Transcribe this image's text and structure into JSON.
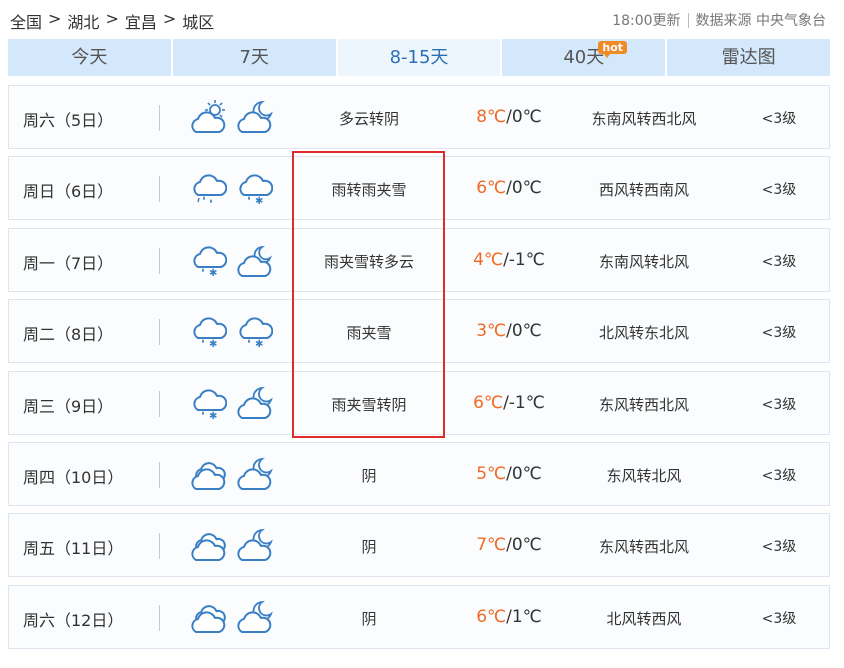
{
  "breadcrumb": {
    "items": [
      "全国",
      "湖北",
      "宜昌",
      "城区"
    ],
    "separator": ">"
  },
  "header": {
    "updated": "18:00更新",
    "source": "数据来源 中央气象台"
  },
  "tabs": [
    {
      "label": "今天"
    },
    {
      "label": "7天"
    },
    {
      "label": "8-15天",
      "active": true
    },
    {
      "label": "40天",
      "badge": "hot"
    },
    {
      "label": "雷达图"
    }
  ],
  "forecast": [
    {
      "day": "周六（5日）",
      "icon_day": "partly-cloudy-day-icon",
      "icon_night": "cloudy-moon-icon",
      "desc": "多云转阴",
      "high": "8℃",
      "low": "/0℃",
      "wind": "东南风转西北风",
      "level": "<3级"
    },
    {
      "day": "周日（6日）",
      "icon_day": "rain-icon",
      "icon_night": "sleet-icon",
      "desc": "雨转雨夹雪",
      "high": "6℃",
      "low": "/0℃",
      "wind": "西风转西南风",
      "level": "<3级"
    },
    {
      "day": "周一（7日）",
      "icon_day": "sleet-icon",
      "icon_night": "partly-cloudy-night-icon",
      "desc": "雨夹雪转多云",
      "high": "4℃",
      "low": "/-1℃",
      "wind": "东南风转北风",
      "level": "<3级"
    },
    {
      "day": "周二（8日）",
      "icon_day": "sleet-icon",
      "icon_night": "sleet-icon",
      "desc": "雨夹雪",
      "high": "3℃",
      "low": "/0℃",
      "wind": "北风转东北风",
      "level": "<3级"
    },
    {
      "day": "周三（9日）",
      "icon_day": "sleet-icon",
      "icon_night": "cloudy-moon-icon",
      "desc": "雨夹雪转阴",
      "high": "6℃",
      "low": "/-1℃",
      "wind": "东风转西北风",
      "level": "<3级"
    },
    {
      "day": "周四（10日）",
      "icon_day": "overcast-icon",
      "icon_night": "cloudy-moon-icon",
      "desc": "阴",
      "high": "5℃",
      "low": "/0℃",
      "wind": "东风转北风",
      "level": "<3级"
    },
    {
      "day": "周五（11日）",
      "icon_day": "overcast-icon",
      "icon_night": "cloudy-moon-icon",
      "desc": "阴",
      "high": "7℃",
      "low": "/0℃",
      "wind": "东风转西北风",
      "level": "<3级"
    },
    {
      "day": "周六（12日）",
      "icon_day": "overcast-icon",
      "icon_night": "cloudy-moon-icon",
      "desc": "阴",
      "high": "6℃",
      "low": "/1℃",
      "wind": "北风转西风",
      "level": "<3级"
    }
  ],
  "colors": {
    "accent": "#2b6fb5",
    "tab_bg": "#d3e8fa",
    "temp_high": "#f06a24",
    "highlight": "#e02b2b",
    "icon": "#3a7fc4"
  }
}
